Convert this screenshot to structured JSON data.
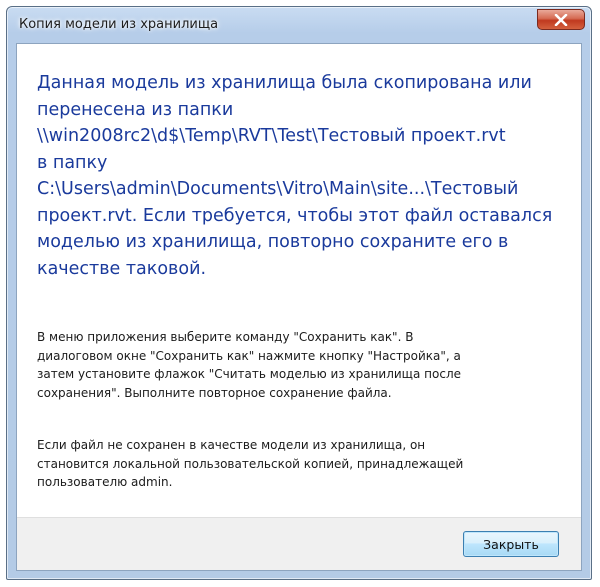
{
  "window": {
    "title": "Копия модели из хранилища"
  },
  "titlebar": {
    "close_icon": "close-icon"
  },
  "content": {
    "main_instruction": "Данная модель из хранилища была скопирована или\nперенесена из папки\n\\\\win2008rc2\\d$\\Temp\\RVT\\Test\\Тестовый проект.rvt\nв папку\nC:\\Users\\admin\\Documents\\Vitro\\Main\\site...\\Тестовый\nпроект.rvt. Если требуется, чтобы этот файл оставался\nмоделью из хранилища, повторно сохраните его в\nкачестве таковой.",
    "paragraph_1": "В меню приложения выберите команду \"Сохранить как\". В\nдиалоговом окне \"Сохранить как\" нажмите кнопку \"Настройка\", а\nзатем установите флажок \"Считать моделью из хранилища после\nсохранения\". Выполните повторное сохранение файла.",
    "paragraph_2": "Если файл не сохранен в качестве модели из хранилища, он\nстановится локальной пользовательской копией, принадлежащей\nпользователю admin."
  },
  "footer": {
    "close_button_label": "Закрыть"
  },
  "colors": {
    "main_instruction": "#1a3a9c",
    "titlebar": "#b6cde9",
    "close_button": "#c0391f"
  }
}
